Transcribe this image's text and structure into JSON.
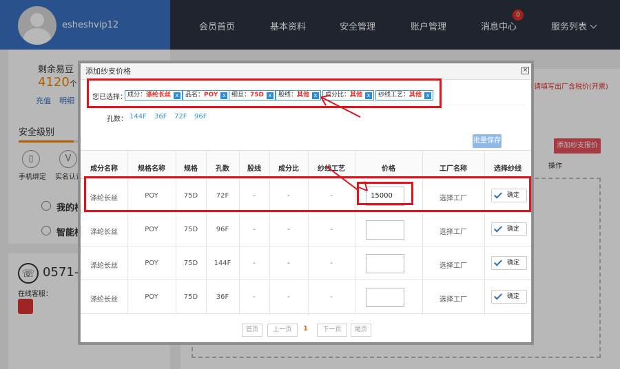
{
  "header": {
    "username": "esheshvip12",
    "nav": [
      "会员首页",
      "基本资料",
      "安全管理",
      "账户管理",
      "消息中心",
      "服务列表"
    ],
    "badge": "0"
  },
  "left": {
    "beans_label": "剩余易豆",
    "beans_value": "4120",
    "beans_unit": "个",
    "links": [
      "充值",
      "明细"
    ],
    "security_label": "安全级别",
    "security_items": [
      "手机绑定",
      "实名认证"
    ],
    "core_items": [
      "我的核",
      "智能核"
    ],
    "phone": "0571-",
    "service_label": "在线客服："
  },
  "right": {
    "note": "请填写出厂含税价(开票)",
    "add_quote": "添加纱支报价",
    "op_col": "操作"
  },
  "modal": {
    "title": "添加纱支价格",
    "chosen_label": "您已选择：",
    "chips": [
      {
        "k": "成分：",
        "v": "涤纶长丝"
      },
      {
        "k": "品名：",
        "v": "POY"
      },
      {
        "k": "细旦：",
        "v": "75D"
      },
      {
        "k": "股线：",
        "v": "其他"
      },
      {
        "k": "成分比：",
        "v": "其他"
      },
      {
        "k": "纱线工艺：",
        "v": "其他"
      }
    ],
    "holes_label": "孔数：",
    "holes": [
      "144F",
      "36F",
      "72F",
      "96F"
    ],
    "batch_save": "批量保存",
    "columns": [
      "成分名称",
      "规格名称",
      "规格",
      "孔数",
      "股线",
      "成分比",
      "纱线工艺",
      "价格",
      "工厂名称",
      "选择纱线"
    ],
    "rows": [
      {
        "c": "涤纶长丝",
        "n": "POY",
        "s": "75D",
        "h": "72F",
        "g": "-",
        "r": "-",
        "p": "-",
        "price": "15000",
        "factory": "选择工厂",
        "btn": "确定"
      },
      {
        "c": "涤纶长丝",
        "n": "POY",
        "s": "75D",
        "h": "96F",
        "g": "-",
        "r": "-",
        "p": "-",
        "price": "",
        "factory": "选择工厂",
        "btn": "确定"
      },
      {
        "c": "涤纶长丝",
        "n": "POY",
        "s": "75D",
        "h": "144F",
        "g": "-",
        "r": "-",
        "p": "-",
        "price": "",
        "factory": "选择工厂",
        "btn": "确定"
      },
      {
        "c": "涤纶长丝",
        "n": "POY",
        "s": "75D",
        "h": "36F",
        "g": "-",
        "r": "-",
        "p": "-",
        "price": "",
        "factory": "选择工厂",
        "btn": "确定"
      }
    ],
    "pager": {
      "first": "首页",
      "prev": "上一页",
      "current": "1",
      "next": "下一页",
      "last": "尾页"
    },
    "close": "×"
  }
}
